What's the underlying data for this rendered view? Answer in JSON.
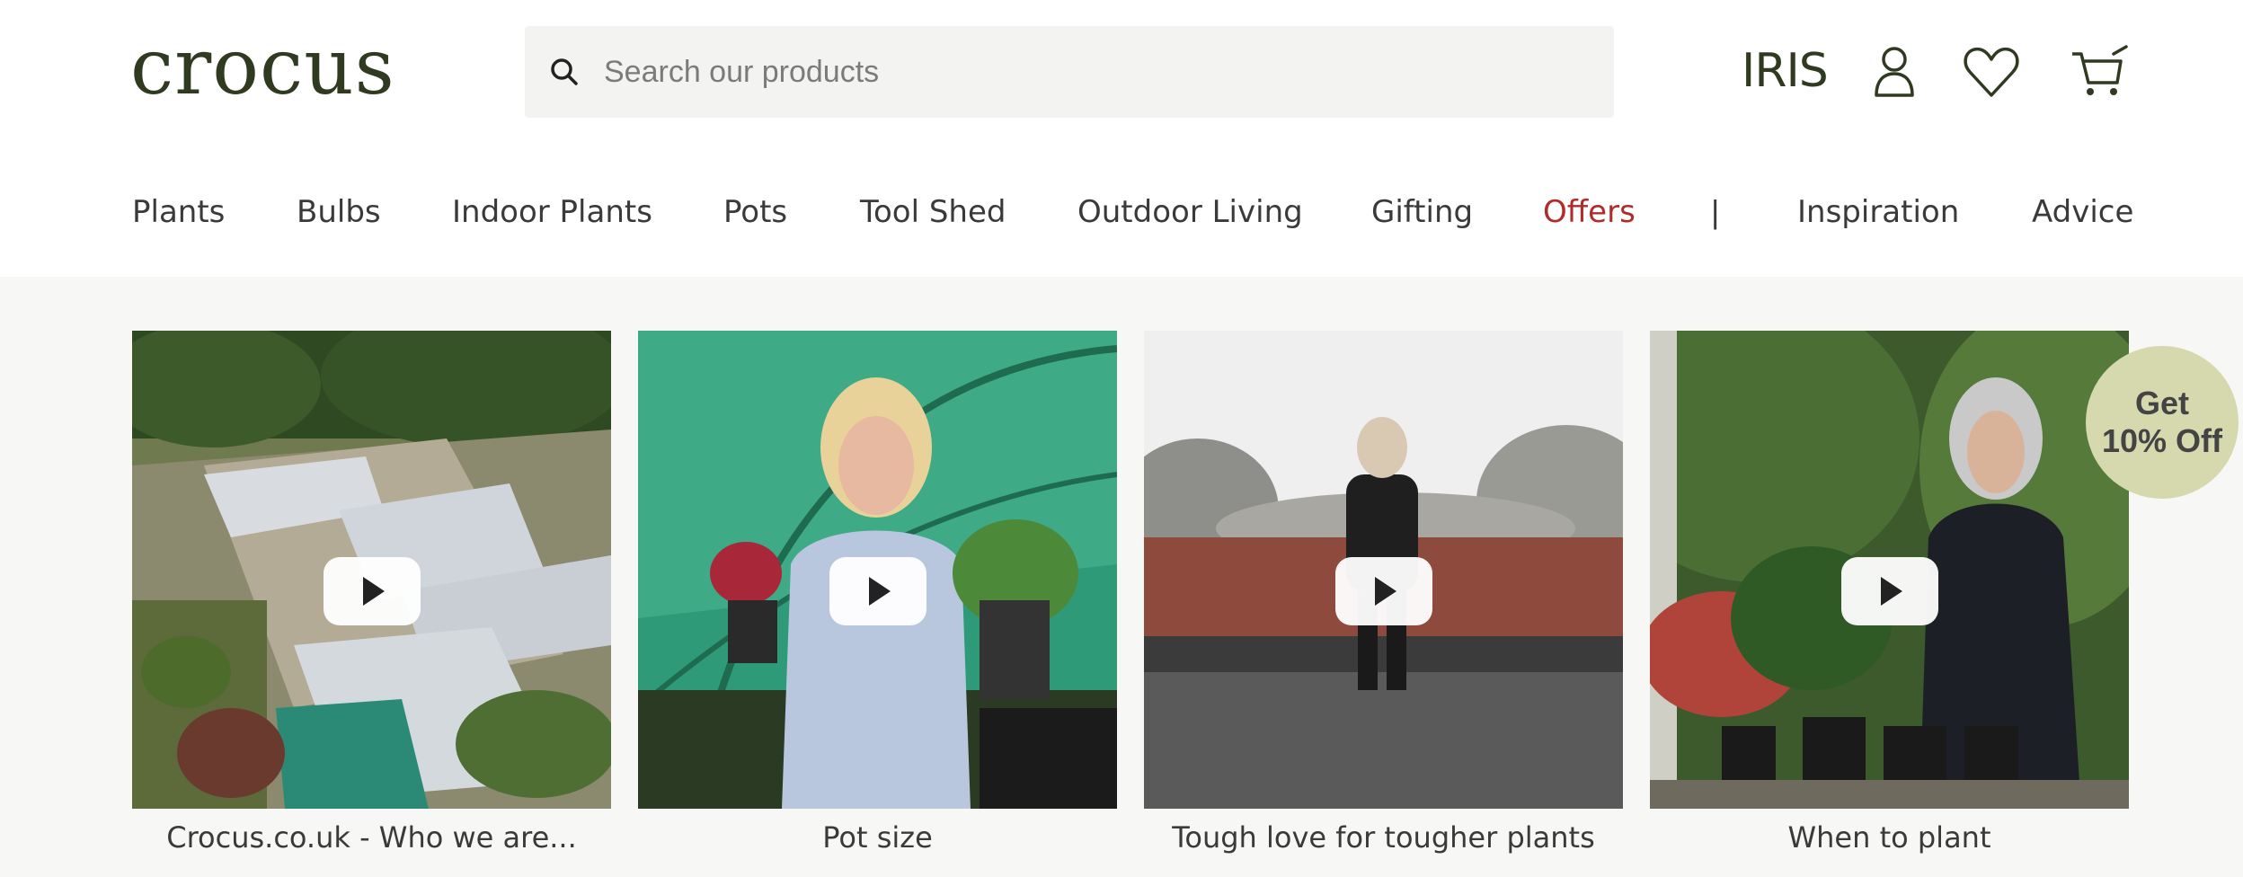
{
  "logo": {
    "text": "crocus"
  },
  "search": {
    "placeholder": "Search our products",
    "icon": "search-icon"
  },
  "header_icons": {
    "brand_text": "IRIS",
    "account": "user-icon",
    "wishlist": "heart-icon",
    "cart": "cart-icon"
  },
  "nav": {
    "items": [
      {
        "label": "Plants"
      },
      {
        "label": "Bulbs"
      },
      {
        "label": "Indoor Plants"
      },
      {
        "label": "Pots"
      },
      {
        "label": "Tool Shed"
      },
      {
        "label": "Outdoor Living"
      },
      {
        "label": "Gifting"
      },
      {
        "label": "Offers"
      },
      {
        "label": "Inspiration"
      },
      {
        "label": "Advice"
      }
    ],
    "separator": "|",
    "accent_color": "#b22a2a"
  },
  "videos": [
    {
      "caption": "Crocus.co.uk - Who we are..."
    },
    {
      "caption": "Pot size"
    },
    {
      "caption": "Tough love for tougher plants"
    },
    {
      "caption": "When to plant"
    }
  ],
  "promo": {
    "line1": "Get",
    "line2": "10% Off"
  },
  "colors": {
    "brand": "#2f3a20",
    "promo_bg": "#d6d8ae",
    "page_bg": "#f7f7f5"
  }
}
